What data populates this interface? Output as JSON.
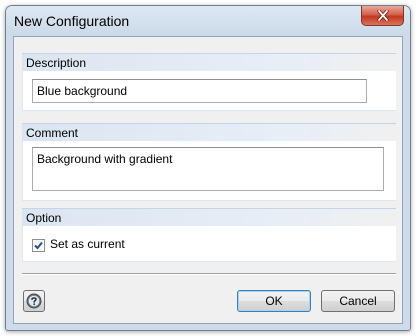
{
  "window": {
    "title": "New Configuration"
  },
  "description": {
    "label": "Description",
    "value": "Blue background"
  },
  "comment": {
    "label": "Comment",
    "value": "Background with gradient"
  },
  "option": {
    "label": "Option",
    "set_current_label": "Set as current",
    "set_current_checked": true
  },
  "buttons": {
    "ok": "OK",
    "cancel": "Cancel"
  },
  "icons": {
    "close": "close-icon",
    "help": "help-icon",
    "check": "checkmark-icon"
  }
}
